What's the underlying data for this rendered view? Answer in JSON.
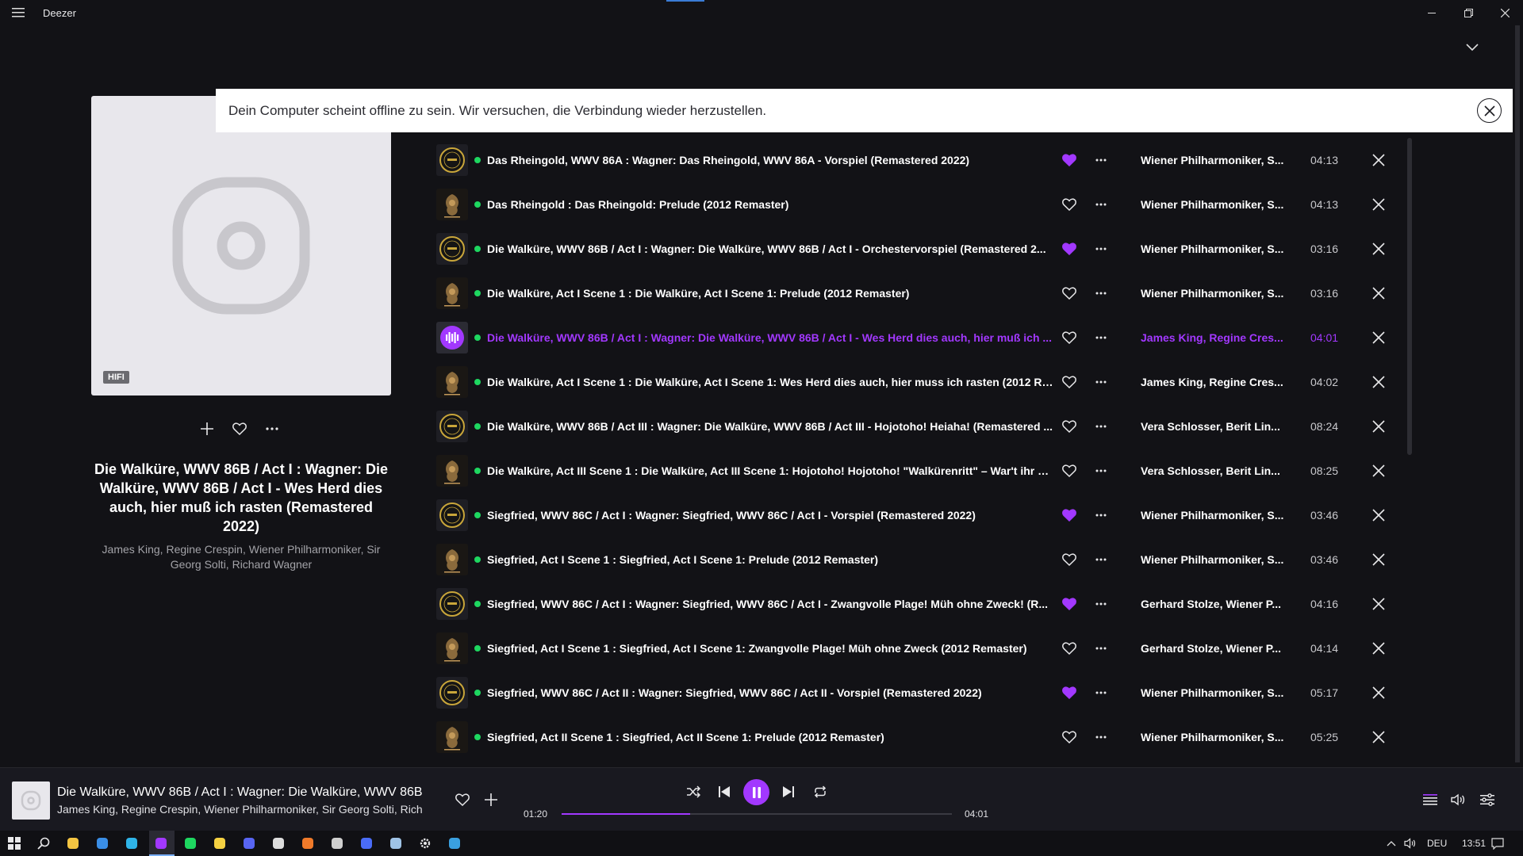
{
  "app": {
    "title": "Deezer"
  },
  "banner": {
    "message": "Dein Computer scheint offline zu sein. Wir versuchen, die Verbindung wieder herzustellen."
  },
  "cover": {
    "badge": "HIFI",
    "title": "Die Walküre, WWV 86B / Act I : Wagner: Die Walküre, WWV 86B / Act I - Wes Herd dies auch, hier muß ich rasten (Remastered 2022)",
    "artists": "James King, Regine Crespin, Wiener Philharmoniker, Sir Georg Solti, Richard Wagner"
  },
  "queue": [
    {
      "title": "Das Rheingold, WWV 86A : Wagner: Das Rheingold, WWV 86A - Vorspiel (Remastered 2022)",
      "artist": "Wiener Philharmoniker, S...",
      "duration": "04:13",
      "liked": true,
      "thumb": "remaster",
      "playing": false
    },
    {
      "title": "Das Rheingold : Das Rheingold: Prelude (2012 Remaster)",
      "artist": "Wiener Philharmoniker, S...",
      "duration": "04:13",
      "liked": false,
      "thumb": "ring",
      "playing": false
    },
    {
      "title": "Die Walküre, WWV 86B / Act I : Wagner: Die Walküre, WWV 86B / Act I - Orchestervorspiel (Remastered 2...",
      "artist": "Wiener Philharmoniker, S...",
      "duration": "03:16",
      "liked": true,
      "thumb": "remaster",
      "playing": false
    },
    {
      "title": "Die Walküre, Act I Scene 1 : Die Walküre, Act I Scene 1: Prelude (2012 Remaster)",
      "artist": "Wiener Philharmoniker, S...",
      "duration": "03:16",
      "liked": false,
      "thumb": "ring",
      "playing": false
    },
    {
      "title": "Die Walküre, WWV 86B / Act I : Wagner: Die Walküre, WWV 86B / Act I - Wes Herd dies auch, hier muß ich ...",
      "artist": "James King, Regine Cres...",
      "duration": "04:01",
      "liked": false,
      "thumb": "playing",
      "playing": true
    },
    {
      "title": "Die Walküre, Act I Scene 1 : Die Walküre, Act I Scene 1: Wes Herd dies auch, hier muss ich rasten (2012 Re...",
      "artist": "James King, Regine Cres...",
      "duration": "04:02",
      "liked": false,
      "thumb": "ring",
      "playing": false
    },
    {
      "title": "Die Walküre, WWV 86B / Act III : Wagner: Die Walküre, WWV 86B / Act III - Hojotoho! Heiaha! (Remastered ...",
      "artist": "Vera Schlosser, Berit Lin...",
      "duration": "08:24",
      "liked": false,
      "thumb": "remaster",
      "playing": false
    },
    {
      "title": "Die Walküre, Act III Scene 1 : Die Walküre, Act III Scene 1: Hojotoho! Hojotoho! \"Walkürenritt\" – War't ihr Kü...",
      "artist": "Vera Schlosser, Berit Lin...",
      "duration": "08:25",
      "liked": false,
      "thumb": "ring",
      "playing": false
    },
    {
      "title": "Siegfried, WWV 86C / Act I : Wagner: Siegfried, WWV 86C / Act I - Vorspiel (Remastered 2022)",
      "artist": "Wiener Philharmoniker, S...",
      "duration": "03:46",
      "liked": true,
      "thumb": "remaster",
      "playing": false
    },
    {
      "title": "Siegfried, Act I Scene 1 : Siegfried, Act I Scene 1: Prelude (2012 Remaster)",
      "artist": "Wiener Philharmoniker, S...",
      "duration": "03:46",
      "liked": false,
      "thumb": "ring",
      "playing": false
    },
    {
      "title": "Siegfried, WWV 86C / Act I : Wagner: Siegfried, WWV 86C / Act I - Zwangvolle Plage! Müh ohne Zweck! (R...",
      "artist": "Gerhard Stolze, Wiener P...",
      "duration": "04:16",
      "liked": true,
      "thumb": "remaster",
      "playing": false
    },
    {
      "title": "Siegfried, Act I Scene 1 : Siegfried, Act I Scene 1: Zwangvolle Plage! Müh ohne Zweck (2012 Remaster)",
      "artist": "Gerhard Stolze, Wiener P...",
      "duration": "04:14",
      "liked": false,
      "thumb": "ring",
      "playing": false
    },
    {
      "title": "Siegfried, WWV 86C / Act II : Wagner: Siegfried, WWV 86C / Act II - Vorspiel (Remastered 2022)",
      "artist": "Wiener Philharmoniker, S...",
      "duration": "05:17",
      "liked": true,
      "thumb": "remaster",
      "playing": false
    },
    {
      "title": "Siegfried, Act II Scene 1 : Siegfried, Act II Scene 1: Prelude (2012 Remaster)",
      "artist": "Wiener Philharmoniker, S...",
      "duration": "05:25",
      "liked": false,
      "thumb": "ring",
      "playing": false
    }
  ],
  "player": {
    "title": "Die Walküre, WWV 86B / Act I : Wagner: Die Walküre, WWV 86B",
    "artists": "James King, Regine Crespin, Wiener Philharmoniker, Sir Georg Solti, Rich",
    "current_time": "01:20",
    "total_time": "04:01",
    "progress": 0.33
  },
  "taskbar": {
    "language": "DEU",
    "clock": "13:51",
    "apps": [
      "windows-start",
      "search",
      "file-explorer",
      "store",
      "edge",
      "deezer",
      "spotify",
      "power-automate",
      "discord",
      "app-dark",
      "app-orange",
      "app-shield",
      "app-blue-chat",
      "notepad",
      "settings",
      "control-panel"
    ]
  },
  "colors": {
    "accent": "#a238ff",
    "online_dot": "#1ed760",
    "background": "#121216",
    "banner_bg": "#ffffff"
  }
}
